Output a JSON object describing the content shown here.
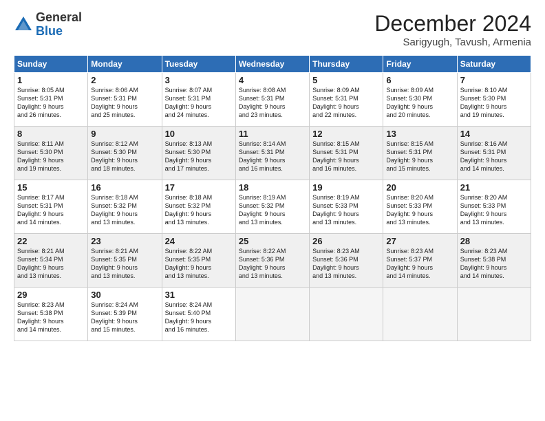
{
  "logo": {
    "general": "General",
    "blue": "Blue"
  },
  "title": "December 2024",
  "location": "Sarigyugh, Tavush, Armenia",
  "days_of_week": [
    "Sunday",
    "Monday",
    "Tuesday",
    "Wednesday",
    "Thursday",
    "Friday",
    "Saturday"
  ],
  "weeks": [
    [
      {
        "day": "1",
        "sunrise": "8:05 AM",
        "sunset": "5:31 PM",
        "daylight": "9 hours and 26 minutes."
      },
      {
        "day": "2",
        "sunrise": "8:06 AM",
        "sunset": "5:31 PM",
        "daylight": "9 hours and 25 minutes."
      },
      {
        "day": "3",
        "sunrise": "8:07 AM",
        "sunset": "5:31 PM",
        "daylight": "9 hours and 24 minutes."
      },
      {
        "day": "4",
        "sunrise": "8:08 AM",
        "sunset": "5:31 PM",
        "daylight": "9 hours and 23 minutes."
      },
      {
        "day": "5",
        "sunrise": "8:09 AM",
        "sunset": "5:31 PM",
        "daylight": "9 hours and 22 minutes."
      },
      {
        "day": "6",
        "sunrise": "8:09 AM",
        "sunset": "5:30 PM",
        "daylight": "9 hours and 20 minutes."
      },
      {
        "day": "7",
        "sunrise": "8:10 AM",
        "sunset": "5:30 PM",
        "daylight": "9 hours and 19 minutes."
      }
    ],
    [
      {
        "day": "8",
        "sunrise": "8:11 AM",
        "sunset": "5:30 PM",
        "daylight": "9 hours and 19 minutes."
      },
      {
        "day": "9",
        "sunrise": "8:12 AM",
        "sunset": "5:30 PM",
        "daylight": "9 hours and 18 minutes."
      },
      {
        "day": "10",
        "sunrise": "8:13 AM",
        "sunset": "5:30 PM",
        "daylight": "9 hours and 17 minutes."
      },
      {
        "day": "11",
        "sunrise": "8:14 AM",
        "sunset": "5:31 PM",
        "daylight": "9 hours and 16 minutes."
      },
      {
        "day": "12",
        "sunrise": "8:15 AM",
        "sunset": "5:31 PM",
        "daylight": "9 hours and 16 minutes."
      },
      {
        "day": "13",
        "sunrise": "8:15 AM",
        "sunset": "5:31 PM",
        "daylight": "9 hours and 15 minutes."
      },
      {
        "day": "14",
        "sunrise": "8:16 AM",
        "sunset": "5:31 PM",
        "daylight": "9 hours and 14 minutes."
      }
    ],
    [
      {
        "day": "15",
        "sunrise": "8:17 AM",
        "sunset": "5:31 PM",
        "daylight": "9 hours and 14 minutes."
      },
      {
        "day": "16",
        "sunrise": "8:18 AM",
        "sunset": "5:32 PM",
        "daylight": "9 hours and 13 minutes."
      },
      {
        "day": "17",
        "sunrise": "8:18 AM",
        "sunset": "5:32 PM",
        "daylight": "9 hours and 13 minutes."
      },
      {
        "day": "18",
        "sunrise": "8:19 AM",
        "sunset": "5:32 PM",
        "daylight": "9 hours and 13 minutes."
      },
      {
        "day": "19",
        "sunrise": "8:19 AM",
        "sunset": "5:33 PM",
        "daylight": "9 hours and 13 minutes."
      },
      {
        "day": "20",
        "sunrise": "8:20 AM",
        "sunset": "5:33 PM",
        "daylight": "9 hours and 13 minutes."
      },
      {
        "day": "21",
        "sunrise": "8:20 AM",
        "sunset": "5:33 PM",
        "daylight": "9 hours and 13 minutes."
      }
    ],
    [
      {
        "day": "22",
        "sunrise": "8:21 AM",
        "sunset": "5:34 PM",
        "daylight": "9 hours and 13 minutes."
      },
      {
        "day": "23",
        "sunrise": "8:21 AM",
        "sunset": "5:35 PM",
        "daylight": "9 hours and 13 minutes."
      },
      {
        "day": "24",
        "sunrise": "8:22 AM",
        "sunset": "5:35 PM",
        "daylight": "9 hours and 13 minutes."
      },
      {
        "day": "25",
        "sunrise": "8:22 AM",
        "sunset": "5:36 PM",
        "daylight": "9 hours and 13 minutes."
      },
      {
        "day": "26",
        "sunrise": "8:23 AM",
        "sunset": "5:36 PM",
        "daylight": "9 hours and 13 minutes."
      },
      {
        "day": "27",
        "sunrise": "8:23 AM",
        "sunset": "5:37 PM",
        "daylight": "9 hours and 14 minutes."
      },
      {
        "day": "28",
        "sunrise": "8:23 AM",
        "sunset": "5:38 PM",
        "daylight": "9 hours and 14 minutes."
      }
    ],
    [
      {
        "day": "29",
        "sunrise": "8:23 AM",
        "sunset": "5:38 PM",
        "daylight": "9 hours and 14 minutes."
      },
      {
        "day": "30",
        "sunrise": "8:24 AM",
        "sunset": "5:39 PM",
        "daylight": "9 hours and 15 minutes."
      },
      {
        "day": "31",
        "sunrise": "8:24 AM",
        "sunset": "5:40 PM",
        "daylight": "9 hours and 16 minutes."
      },
      null,
      null,
      null,
      null
    ]
  ]
}
